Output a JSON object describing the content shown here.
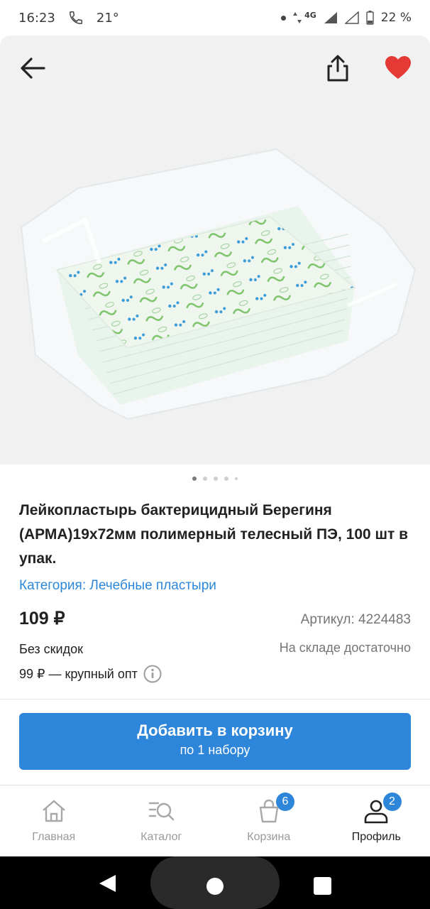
{
  "status_bar": {
    "time": "16:23",
    "temperature": "21°",
    "network": "4G",
    "battery": "22 %"
  },
  "header": {
    "back_icon": "arrow-left-icon",
    "share_icon": "share-icon",
    "favorite_icon": "heart-icon",
    "favorite_color": "#e53935"
  },
  "gallery": {
    "dots_total": 5,
    "active_index": 0
  },
  "product": {
    "title": "Лейкопластырь бактерицидный Берегиня (АРМА)19х72мм полимерный телесный ПЭ, 100 шт в упак.",
    "category": "Категория: Лечебные пластыри",
    "price": "109 ₽",
    "sku": "Артикул: 4224483",
    "discount": "Без скидок",
    "stock": "На складе достаточно",
    "wholesale": "99 ₽ — крупный опт"
  },
  "cart_button": {
    "label": "Добавить в корзину",
    "sublabel": "по 1 набору",
    "color": "#2d86d9"
  },
  "bottom_nav": {
    "items": [
      {
        "label": "Главная",
        "icon": "home-icon"
      },
      {
        "label": "Каталог",
        "icon": "catalog-search-icon"
      },
      {
        "label": "Корзина",
        "icon": "cart-bag-icon",
        "badge": "6"
      },
      {
        "label": "Профиль",
        "icon": "profile-icon",
        "badge": "2"
      }
    ]
  }
}
